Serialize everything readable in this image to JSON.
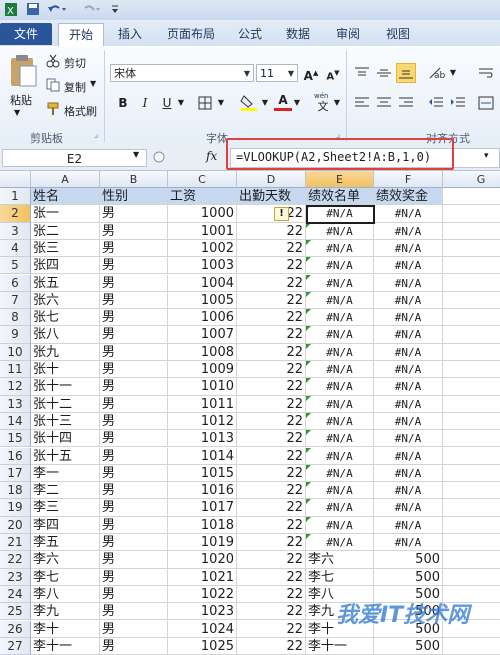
{
  "tabs": [
    "文件",
    "开始",
    "插入",
    "页面布局",
    "公式",
    "数据",
    "审阅",
    "视图"
  ],
  "ribbon": {
    "clipboard": {
      "paste": "粘贴",
      "cut": "剪切",
      "copy": "复制",
      "format_painter": "格式刷",
      "group_label": "剪贴板"
    },
    "font": {
      "name": "宋体",
      "size": "11",
      "grow": "A",
      "shrink": "A",
      "bold": "B",
      "italic": "I",
      "underline": "U",
      "group_label": "字体",
      "wen": "wén"
    },
    "alignment": {
      "group_label": "对齐方式"
    }
  },
  "formula_bar": {
    "name_box": "E2",
    "fx": "fx",
    "formula": "=VLOOKUP(A2,Sheet2!A:B,1,0)"
  },
  "columns": [
    "A",
    "B",
    "C",
    "D",
    "E",
    "F",
    "G"
  ],
  "selected_cell": "E2",
  "header_row": [
    "姓名",
    "性别",
    "工资",
    "出勤天数",
    "绩效名单",
    "绩效奖金"
  ],
  "rows": [
    [
      "张一",
      "男",
      "1000",
      "22",
      "#N/A",
      "#N/A"
    ],
    [
      "张二",
      "男",
      "1001",
      "22",
      "#N/A",
      "#N/A"
    ],
    [
      "张三",
      "男",
      "1002",
      "22",
      "#N/A",
      "#N/A"
    ],
    [
      "张四",
      "男",
      "1003",
      "22",
      "#N/A",
      "#N/A"
    ],
    [
      "张五",
      "男",
      "1004",
      "22",
      "#N/A",
      "#N/A"
    ],
    [
      "张六",
      "男",
      "1005",
      "22",
      "#N/A",
      "#N/A"
    ],
    [
      "张七",
      "男",
      "1006",
      "22",
      "#N/A",
      "#N/A"
    ],
    [
      "张八",
      "男",
      "1007",
      "22",
      "#N/A",
      "#N/A"
    ],
    [
      "张九",
      "男",
      "1008",
      "22",
      "#N/A",
      "#N/A"
    ],
    [
      "张十",
      "男",
      "1009",
      "22",
      "#N/A",
      "#N/A"
    ],
    [
      "张十一",
      "男",
      "1010",
      "22",
      "#N/A",
      "#N/A"
    ],
    [
      "张十二",
      "男",
      "1011",
      "22",
      "#N/A",
      "#N/A"
    ],
    [
      "张十三",
      "男",
      "1012",
      "22",
      "#N/A",
      "#N/A"
    ],
    [
      "张十四",
      "男",
      "1013",
      "22",
      "#N/A",
      "#N/A"
    ],
    [
      "张十五",
      "男",
      "1014",
      "22",
      "#N/A",
      "#N/A"
    ],
    [
      "李一",
      "男",
      "1015",
      "22",
      "#N/A",
      "#N/A"
    ],
    [
      "李二",
      "男",
      "1016",
      "22",
      "#N/A",
      "#N/A"
    ],
    [
      "李三",
      "男",
      "1017",
      "22",
      "#N/A",
      "#N/A"
    ],
    [
      "李四",
      "男",
      "1018",
      "22",
      "#N/A",
      "#N/A"
    ],
    [
      "李五",
      "男",
      "1019",
      "22",
      "#N/A",
      "#N/A"
    ],
    [
      "李六",
      "男",
      "1020",
      "22",
      "李六",
      "500"
    ],
    [
      "李七",
      "男",
      "1021",
      "22",
      "李七",
      "500"
    ],
    [
      "李八",
      "男",
      "1022",
      "22",
      "李八",
      "500"
    ],
    [
      "李九",
      "男",
      "1023",
      "22",
      "李九",
      "500"
    ],
    [
      "李十",
      "男",
      "1024",
      "22",
      "李十",
      "500"
    ],
    [
      "李十一",
      "男",
      "1025",
      "22",
      "李十一",
      "500"
    ]
  ],
  "watermark": "我爱IT技术网",
  "colors": {
    "file_tab": "#2a5699",
    "header_fill": "#c6d9f1",
    "highlight": "#e0403c",
    "error_tri": "#2f9a3a"
  }
}
